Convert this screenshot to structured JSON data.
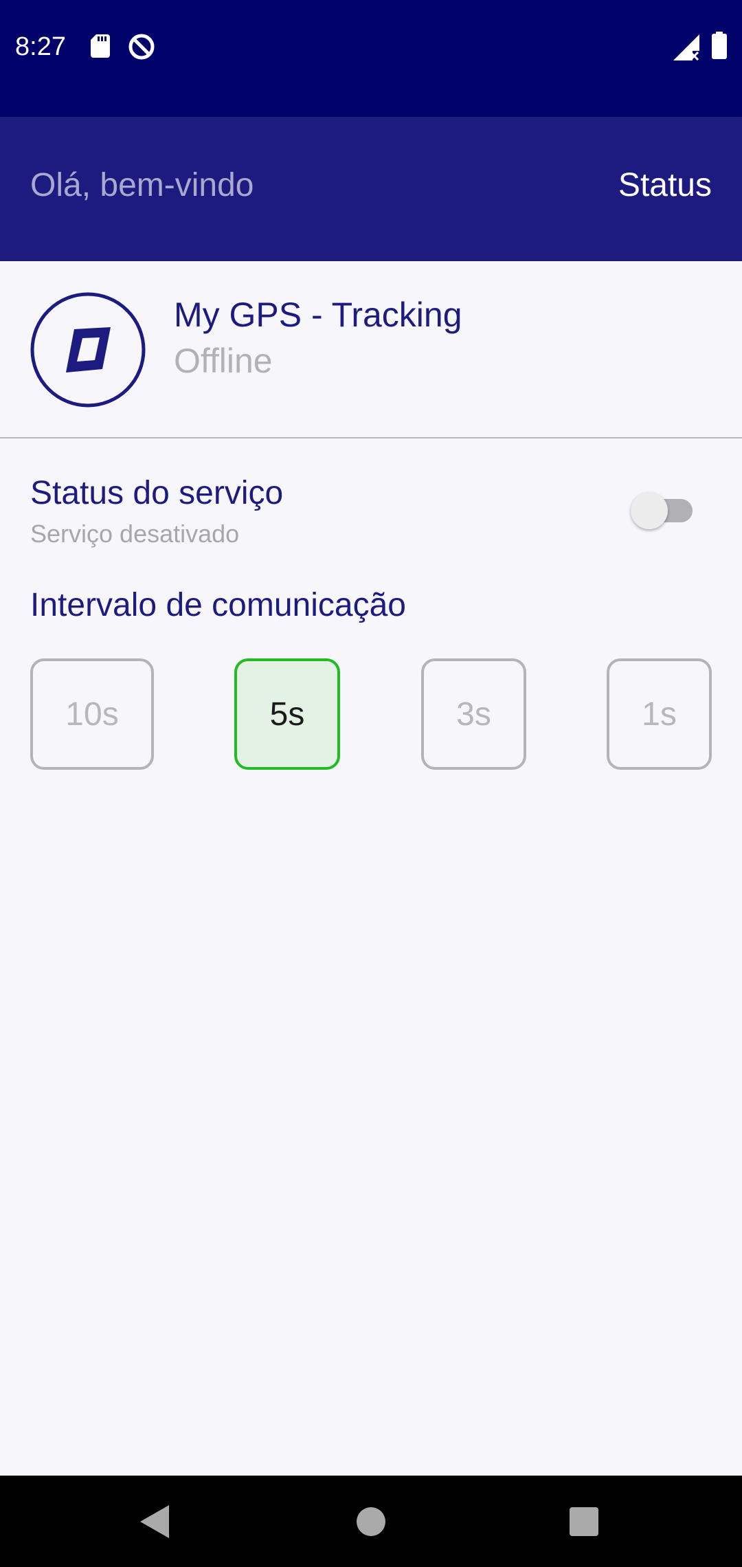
{
  "status_bar": {
    "time": "8:27",
    "icons": [
      "sd-card-icon",
      "no-disturb-icon",
      "signal-no-service-icon",
      "battery-icon"
    ]
  },
  "header": {
    "greeting": "Olá, bem-vindo",
    "status_label": "Status"
  },
  "app_info": {
    "logo_icon": "compass-logo-icon",
    "name": "My GPS - Tracking",
    "state": "Offline"
  },
  "service": {
    "title": "Status do serviço",
    "subtitle": "Serviço desativado",
    "enabled": false
  },
  "interval": {
    "title": "Intervalo de comunicação",
    "options": [
      {
        "label": "10s",
        "selected": false
      },
      {
        "label": "5s",
        "selected": true
      },
      {
        "label": "3s",
        "selected": false
      },
      {
        "label": "1s",
        "selected": false
      }
    ]
  },
  "nav_bar": {
    "buttons": [
      "back-icon",
      "home-icon",
      "recents-icon"
    ]
  },
  "colors": {
    "status_bar": "#02026b",
    "header": "#1d1b80",
    "accent_text": "#1d1b80",
    "selected_border": "#22bb22",
    "selected_fill": "#e4f1e5"
  }
}
